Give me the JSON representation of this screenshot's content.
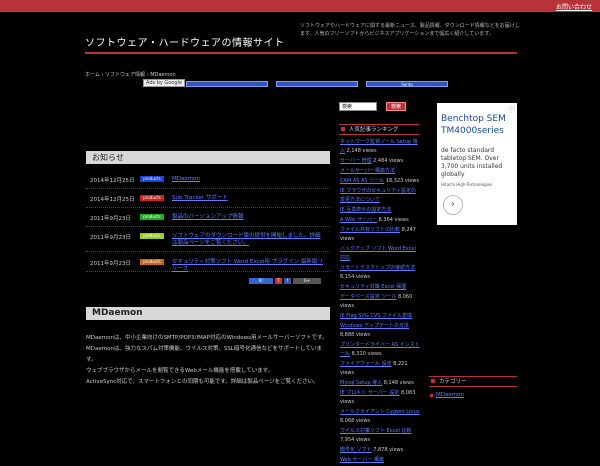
{
  "top_link": "お問い合わせ",
  "site_title": "ソフトウェア・ハードウェアの情報サイト",
  "site_desc": "ソフトウェアやハードウェアに関する最新ニュース、製品情報、ダウンロード情報などをお届けします。人気のフリーソフトからビジネスアプリケーションまで幅広く紹介しています。",
  "breadcrumb": "ホーム › ソフトウェア情報 › MDaemon",
  "ads_label": "Ads by Google",
  "ad_links": [
    "",
    "",
    "Sento"
  ],
  "news_heading": "お知らせ",
  "news": [
    {
      "date": "2014年12月25日",
      "tag": "products",
      "title": "MDaemon",
      "color": "#2244cc"
    },
    {
      "date": "2014年12月25日",
      "tag": "products",
      "title": "Sub Tracker サポート",
      "color": "#cc2222"
    },
    {
      "date": "2011年9月23日",
      "tag": "products",
      "title": "製品のバージョンアップ情報",
      "color": "#22aa22"
    },
    {
      "date": "2011年9月23日",
      "tag": "products",
      "title": "ソフトウェアのダウンロード版の提供を開始しました。詳細は製品ページをご覧ください。",
      "color": "#99cc22"
    },
    {
      "date": "2011年9月23日",
      "tag": "products",
      "title": "セキュリティ対策ソフト Word Excel用 プラグイン 最新版リリース",
      "color": "#cc6611"
    }
  ],
  "share_buttons": [
    "B!",
    "T",
    "f",
    "G+"
  ],
  "mdaemon_heading": "MDaemon",
  "mdaemon_body": [
    "MDaemonは、中小企業向けのSMTP/POP3/IMAP対応のWindows用メールサーバーソフトです。",
    "MDaemonは、強力なスパム対策機能、ウイルス対策、SSL暗号化通信などをサポートしています。",
    "ウェブブラウザからメールを閲覧できるWebメール機能を搭載しています。",
    "ActiveSync対応で、スマートフォンとの同期も可能です。詳細は製品ページをご覧ください。"
  ],
  "search": {
    "value": "検索",
    "button": "検索"
  },
  "ranking_heading": "人気記事ランキング",
  "ranking": [
    {
      "title": "ネットワーク監視ツール Setup 導入",
      "views": "2,148 views"
    },
    {
      "title": "サーバー 管理",
      "views": "2,484 views"
    },
    {
      "title": "メールサーバー構築方法",
      "views": ""
    },
    {
      "title": "CAM AS AS ツール",
      "views": "18,323 views"
    },
    {
      "title": "IE ブラウザのセキュリティ設定の変更方法について",
      "views": ""
    },
    {
      "title": "IE 互換表示の設定方法",
      "views": ""
    },
    {
      "title": "A Wiki サーバー",
      "views": "8,364 views"
    },
    {
      "title": "ファイル共有ソフトの比較",
      "views": "8,247 views"
    },
    {
      "title": "バックアップ ソフト Word Excel 対応",
      "views": ""
    },
    {
      "title": "リモートデスクトップの接続方法",
      "views": "8,154 views"
    },
    {
      "title": "セキュリティ対策 Excel 保護",
      "views": ""
    },
    {
      "title": "データベース設定 ツール",
      "views": "8,060 views"
    },
    {
      "title": "IE Flag SVG CVS ファイル変換",
      "views": ""
    },
    {
      "title": "Windows アップデートの方法",
      "views": "8,888 views"
    },
    {
      "title": "プリンタードライバー AS インストール",
      "views": "8,310 views"
    },
    {
      "title": "ファイアウォール 設定",
      "views": "8,221 views"
    },
    {
      "title": "Mysql Setup 導入",
      "views": "8,148 views"
    },
    {
      "title": "IE プロキシ サーバー 設定",
      "views": "8,083 views"
    },
    {
      "title": "メールクライアント Cygwin Linux",
      "views": "8,068 views"
    },
    {
      "title": "ウイルス対策ソフト Excel 比較",
      "views": "7,954 views"
    },
    {
      "title": "暗号化 ソフト",
      "views": "7,878 views"
    },
    {
      "title": "Web サーバー 構築",
      "views": ""
    }
  ],
  "ad_box": {
    "title": "Benchtop SEM TM4000series",
    "text": "de facto standard tabletop SEM. Over 3,700 units installed globally",
    "source": "Hitachi High-Technologies",
    "arrow": "›",
    "info": "ⓘ"
  },
  "category_heading": "カテゴリー",
  "category_item": "MDaemon"
}
